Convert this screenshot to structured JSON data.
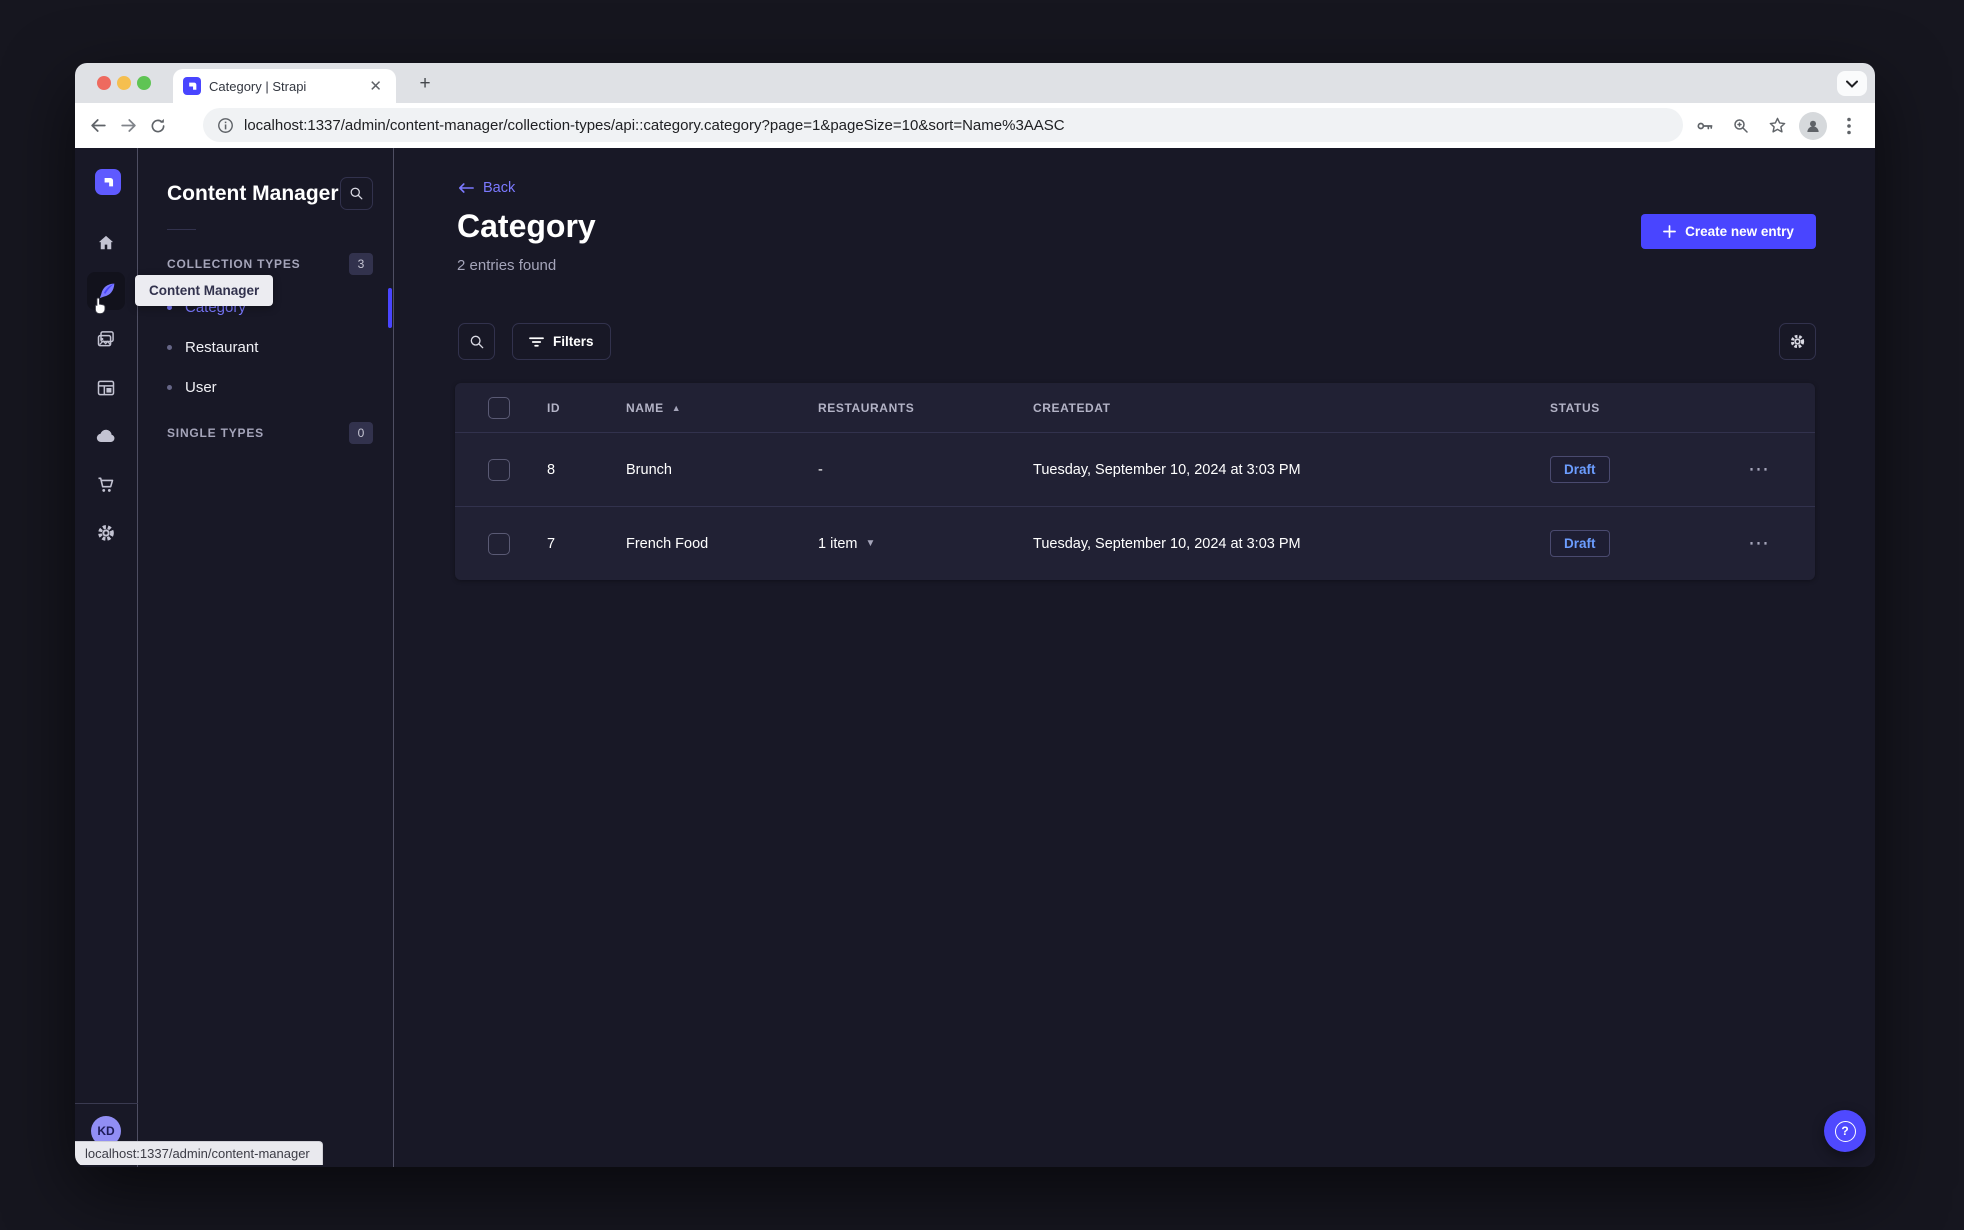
{
  "browser": {
    "tab_title": "Category | Strapi",
    "url": "localhost:1337/admin/content-manager/collection-types/api::category.category?page=1&pageSize=10&sort=Name%3AASC",
    "status_bubble": "localhost:1337/admin/content-manager"
  },
  "sidebar": {
    "icons": [
      "strapi-logo",
      "home",
      "content-manager",
      "media-library",
      "content-type-builder",
      "cloud",
      "marketplace",
      "settings"
    ],
    "avatar_initials": "KD",
    "tooltip": "Content Manager"
  },
  "subnav": {
    "title": "Content Manager",
    "collection_types": {
      "label": "COLLECTION TYPES",
      "count": "3",
      "items": [
        {
          "label": "Category",
          "active": true
        },
        {
          "label": "Restaurant",
          "active": false
        },
        {
          "label": "User",
          "active": false
        }
      ]
    },
    "single_types": {
      "label": "SINGLE TYPES",
      "count": "0"
    }
  },
  "main": {
    "back_label": "Back",
    "title": "Category",
    "subtitle": "2 entries found",
    "create_button": "Create new entry",
    "filters_button": "Filters"
  },
  "table": {
    "headers": {
      "id": "ID",
      "name": "NAME",
      "restaurants": "RESTAURANTS",
      "createdat": "CREATEDAT",
      "status": "STATUS"
    },
    "rows": [
      {
        "id": "8",
        "name": "Brunch",
        "restaurants": "-",
        "createdat": "Tuesday, September 10, 2024 at 3:03 PM",
        "status": "Draft"
      },
      {
        "id": "7",
        "name": "French Food",
        "restaurants": "1 item",
        "createdat": "Tuesday, September 10, 2024 at 3:03 PM",
        "status": "Draft"
      }
    ]
  },
  "colors": {
    "accent": "#4945ff",
    "link": "#7b79ff",
    "app-bg": "#181826",
    "panel-bg": "#212134",
    "border-col": "#32324d",
    "muted": "#a5a5ba",
    "draft-text": "#6c9dff",
    "draft-border": "#4a4a6f"
  }
}
